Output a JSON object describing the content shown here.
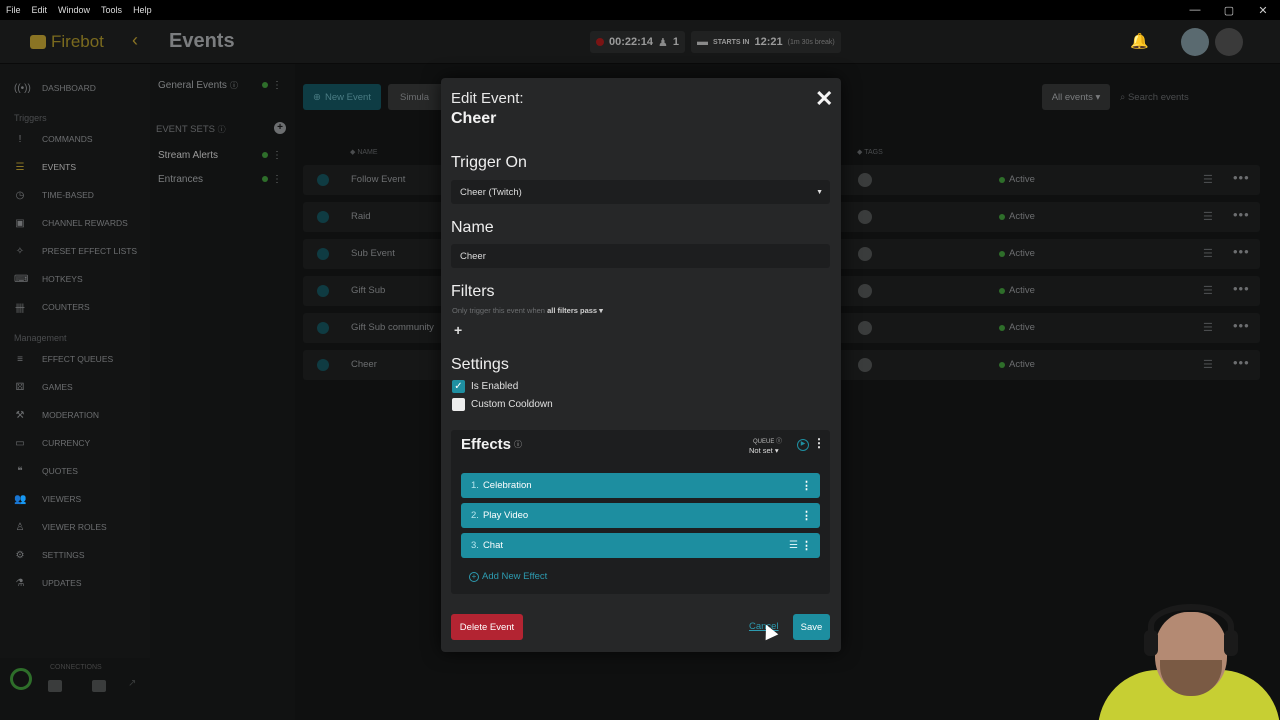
{
  "menu": [
    "File",
    "Edit",
    "Window",
    "Tools",
    "Help"
  ],
  "window_controls": [
    "—",
    "▢",
    "✕"
  ],
  "header": {
    "app_name": "Firebot",
    "page_title": "Events",
    "stream_time": "00:22:14",
    "viewers": "1",
    "starts_in_label": "STARTS IN",
    "starts_in_time": "12:21",
    "starts_in_note": "(1m 30s break)"
  },
  "sidebar": {
    "dashboard": "DASHBOARD",
    "triggers_label": "Triggers",
    "triggers": [
      "COMMANDS",
      "EVENTS",
      "TIME-BASED",
      "CHANNEL REWARDS",
      "PRESET EFFECT LISTS",
      "HOTKEYS",
      "COUNTERS"
    ],
    "management_label": "Management",
    "management": [
      "EFFECT QUEUES",
      "GAMES",
      "MODERATION",
      "CURRENCY",
      "QUOTES",
      "VIEWERS",
      "VIEWER ROLES",
      "SETTINGS",
      "UPDATES"
    ],
    "connections_label": "CONNECTIONS"
  },
  "event_sets": {
    "general": "General Events",
    "header": "EVENT SETS",
    "items": [
      "Stream Alerts",
      "Entrances"
    ]
  },
  "toolbar": {
    "new_event": "New Event",
    "simulate": "Simula",
    "filter": "All events",
    "search_placeholder": "Search events"
  },
  "table": {
    "col_name": "NAME",
    "col_tags": "TAGS",
    "rows": [
      {
        "name": "Follow Event",
        "status": "Active"
      },
      {
        "name": "Raid",
        "status": "Active"
      },
      {
        "name": "Sub Event",
        "status": "Active"
      },
      {
        "name": "Gift Sub",
        "status": "Active"
      },
      {
        "name": "Gift Sub community",
        "status": "Active"
      },
      {
        "name": "Cheer",
        "status": "Active"
      }
    ]
  },
  "modal": {
    "title": "Edit Event:",
    "subtitle": "Cheer",
    "trigger_heading": "Trigger On",
    "trigger_value": "Cheer (Twitch)",
    "name_heading": "Name",
    "name_value": "Cheer",
    "filters_heading": "Filters",
    "filters_text": "Only trigger this event when",
    "filters_mode": "all filters pass",
    "settings_heading": "Settings",
    "enabled_label": "Is Enabled",
    "cooldown_label": "Custom Cooldown",
    "effects_heading": "Effects",
    "queue_label": "QUEUE",
    "queue_value": "Not set",
    "effects": [
      {
        "index": "1.",
        "name": "Celebration"
      },
      {
        "index": "2.",
        "name": "Play Video"
      },
      {
        "index": "3.",
        "name": "Chat"
      }
    ],
    "add_effect": "Add New Effect",
    "delete_label": "Delete Event",
    "cancel_label": "Cancel",
    "save_label": "Save"
  },
  "colors": {
    "accent": "#1d8ea0",
    "danger": "#b32432",
    "active": "#2e6e2a",
    "brand": "#8a7424"
  }
}
